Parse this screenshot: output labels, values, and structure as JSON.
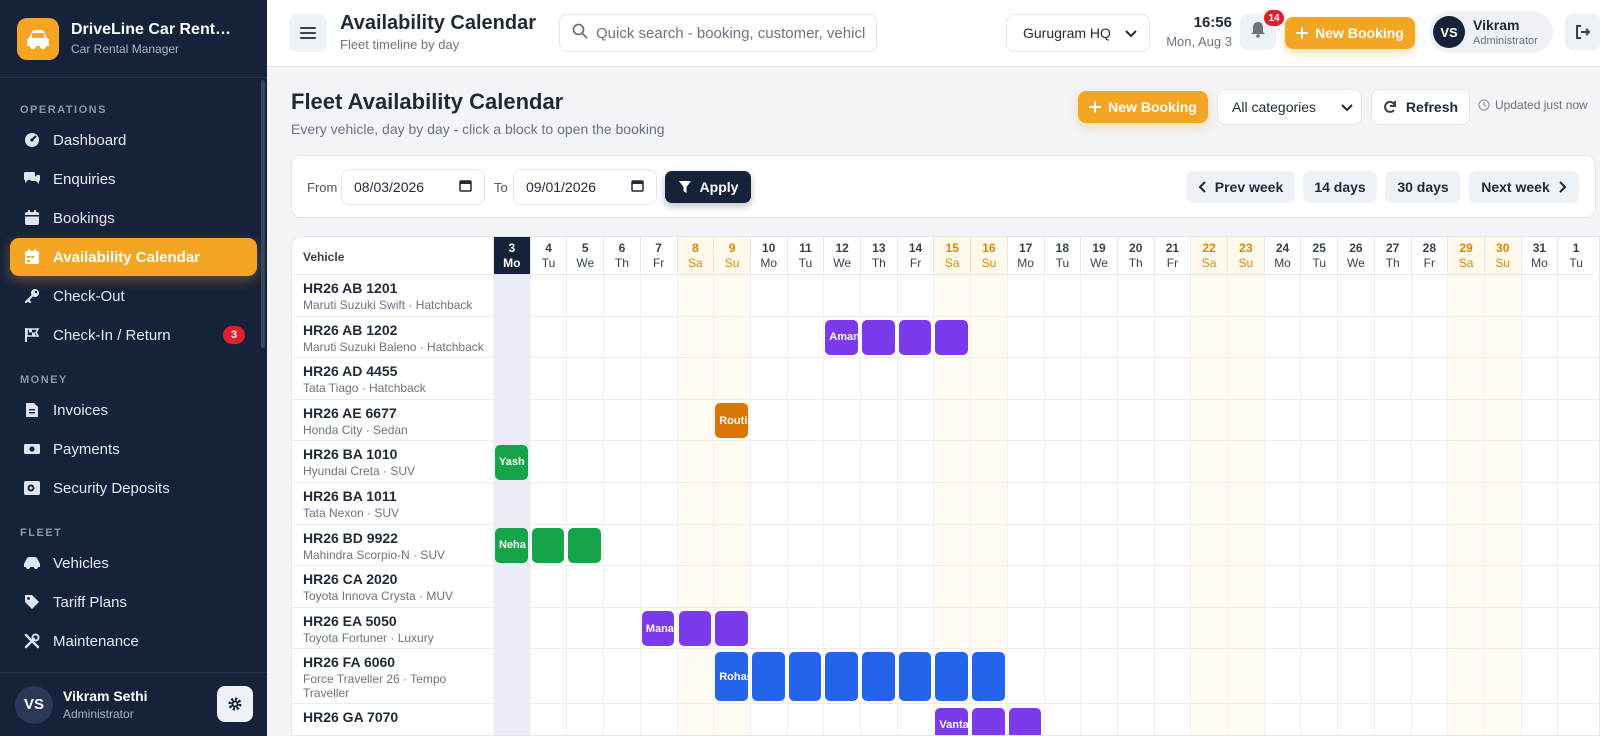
{
  "brand": {
    "title": "DriveLine Car Rent…",
    "subtitle": "Car Rental Manager",
    "logo_icon": "car-icon"
  },
  "sidebar": {
    "sections": [
      {
        "label": "OPERATIONS",
        "items": [
          {
            "label": "Dashboard",
            "icon": "gauge-icon"
          },
          {
            "label": "Enquiries",
            "icon": "chat-icon"
          },
          {
            "label": "Bookings",
            "icon": "calendar-check-icon"
          },
          {
            "label": "Availability Calendar",
            "icon": "calendar-icon",
            "active": true
          },
          {
            "label": "Check-Out",
            "icon": "key-icon"
          },
          {
            "label": "Check-In / Return",
            "icon": "flag-icon",
            "badge": "3"
          }
        ]
      },
      {
        "label": "MONEY",
        "items": [
          {
            "label": "Invoices",
            "icon": "invoice-icon"
          },
          {
            "label": "Payments",
            "icon": "cash-icon"
          },
          {
            "label": "Security Deposits",
            "icon": "deposit-icon"
          }
        ]
      },
      {
        "label": "FLEET",
        "items": [
          {
            "label": "Vehicles",
            "icon": "car-icon"
          },
          {
            "label": "Tariff Plans",
            "icon": "tag-icon"
          },
          {
            "label": "Maintenance",
            "icon": "tools-icon"
          }
        ]
      }
    ],
    "user": {
      "initials": "VS",
      "name": "Vikram Sethi",
      "role": "Administrator"
    }
  },
  "topbar": {
    "title": "Availability Calendar",
    "subtitle": "Fleet timeline by day",
    "search_placeholder": "Quick search - booking, customer, vehicle",
    "branch": "Gurugram HQ",
    "time": "16:56",
    "date": "Mon, Aug 3",
    "notifications": "14",
    "new_booking": "New Booking",
    "user": {
      "initials": "VS",
      "name": "Vikram",
      "role": "Administrator"
    }
  },
  "page": {
    "title": "Fleet Availability Calendar",
    "subtitle": "Every vehicle, day by day - click a block to open the booking",
    "new_booking": "New Booking",
    "category": "All categories",
    "refresh": "Refresh",
    "updated": "Updated just now"
  },
  "filter": {
    "from_label": "From",
    "from_value": "08/03/2026",
    "to_label": "To",
    "to_value": "09/01/2026",
    "apply": "Apply",
    "prev_week": "Prev week",
    "days14": "14 days",
    "days30": "30 days",
    "next_week": "Next week"
  },
  "calendar": {
    "vehicle_header": "Vehicle",
    "days": [
      {
        "n": "3",
        "d": "Mo",
        "today": true
      },
      {
        "n": "4",
        "d": "Tu"
      },
      {
        "n": "5",
        "d": "We"
      },
      {
        "n": "6",
        "d": "Th"
      },
      {
        "n": "7",
        "d": "Fr"
      },
      {
        "n": "8",
        "d": "Sa",
        "weekend": true
      },
      {
        "n": "9",
        "d": "Su",
        "weekend": true
      },
      {
        "n": "10",
        "d": "Mo"
      },
      {
        "n": "11",
        "d": "Tu"
      },
      {
        "n": "12",
        "d": "We"
      },
      {
        "n": "13",
        "d": "Th"
      },
      {
        "n": "14",
        "d": "Fr"
      },
      {
        "n": "15",
        "d": "Sa",
        "weekend": true
      },
      {
        "n": "16",
        "d": "Su",
        "weekend": true
      },
      {
        "n": "17",
        "d": "Mo"
      },
      {
        "n": "18",
        "d": "Tu"
      },
      {
        "n": "19",
        "d": "We"
      },
      {
        "n": "20",
        "d": "Th"
      },
      {
        "n": "21",
        "d": "Fr"
      },
      {
        "n": "22",
        "d": "Sa",
        "weekend": true
      },
      {
        "n": "23",
        "d": "Su",
        "weekend": true
      },
      {
        "n": "24",
        "d": "Mo"
      },
      {
        "n": "25",
        "d": "Tu"
      },
      {
        "n": "26",
        "d": "We"
      },
      {
        "n": "27",
        "d": "Th"
      },
      {
        "n": "28",
        "d": "Fr"
      },
      {
        "n": "29",
        "d": "Sa",
        "weekend": true
      },
      {
        "n": "30",
        "d": "Su",
        "weekend": true
      },
      {
        "n": "31",
        "d": "Mo"
      },
      {
        "n": "1",
        "d": "Tu"
      }
    ],
    "vehicles": [
      {
        "plate": "HR26 AB 1201",
        "model": "Maruti Suzuki Swift · Hatchback",
        "bookings": []
      },
      {
        "plate": "HR26 AB 1202",
        "model": "Maruti Suzuki Baleno · Hatchback",
        "bookings": [
          {
            "start": 9,
            "days": 4,
            "label": "Aman",
            "color": "purple"
          }
        ]
      },
      {
        "plate": "HR26 AD 4455",
        "model": "Tata Tiago · Hatchback",
        "bookings": []
      },
      {
        "plate": "HR26 AE 6677",
        "model": "Honda City · Sedan",
        "bookings": [
          {
            "start": 6,
            "days": 1,
            "label": "Routine",
            "color": "orange"
          }
        ]
      },
      {
        "plate": "HR26 BA 1010",
        "model": "Hyundai Creta · SUV",
        "bookings": [
          {
            "start": 0,
            "days": 1,
            "label": "Yash",
            "color": "green"
          }
        ]
      },
      {
        "plate": "HR26 BA 1011",
        "model": "Tata Nexon · SUV",
        "bookings": []
      },
      {
        "plate": "HR26 BD 9922",
        "model": "Mahindra Scorpio-N · SUV",
        "bookings": [
          {
            "start": 0,
            "days": 3,
            "label": "Neha",
            "color": "green"
          }
        ]
      },
      {
        "plate": "HR26 CA 2020",
        "model": "Toyota Innova Crysta · MUV",
        "bookings": []
      },
      {
        "plate": "HR26 EA 5050",
        "model": "Toyota Fortuner · Luxury",
        "bookings": [
          {
            "start": 4,
            "days": 3,
            "label": "Manav",
            "color": "purple"
          }
        ]
      },
      {
        "plate": "HR26 FA 6060",
        "model": "Force Traveller 26 · Tempo Traveller",
        "tall": true,
        "bookings": [
          {
            "start": 6,
            "days": 8,
            "label": "Rohan",
            "color": "blue"
          }
        ]
      },
      {
        "plate": "HR26 GA 7070",
        "model": "",
        "bookings": [
          {
            "start": 12,
            "days": 3,
            "label": "Vantage",
            "color": "purple"
          }
        ]
      }
    ]
  }
}
